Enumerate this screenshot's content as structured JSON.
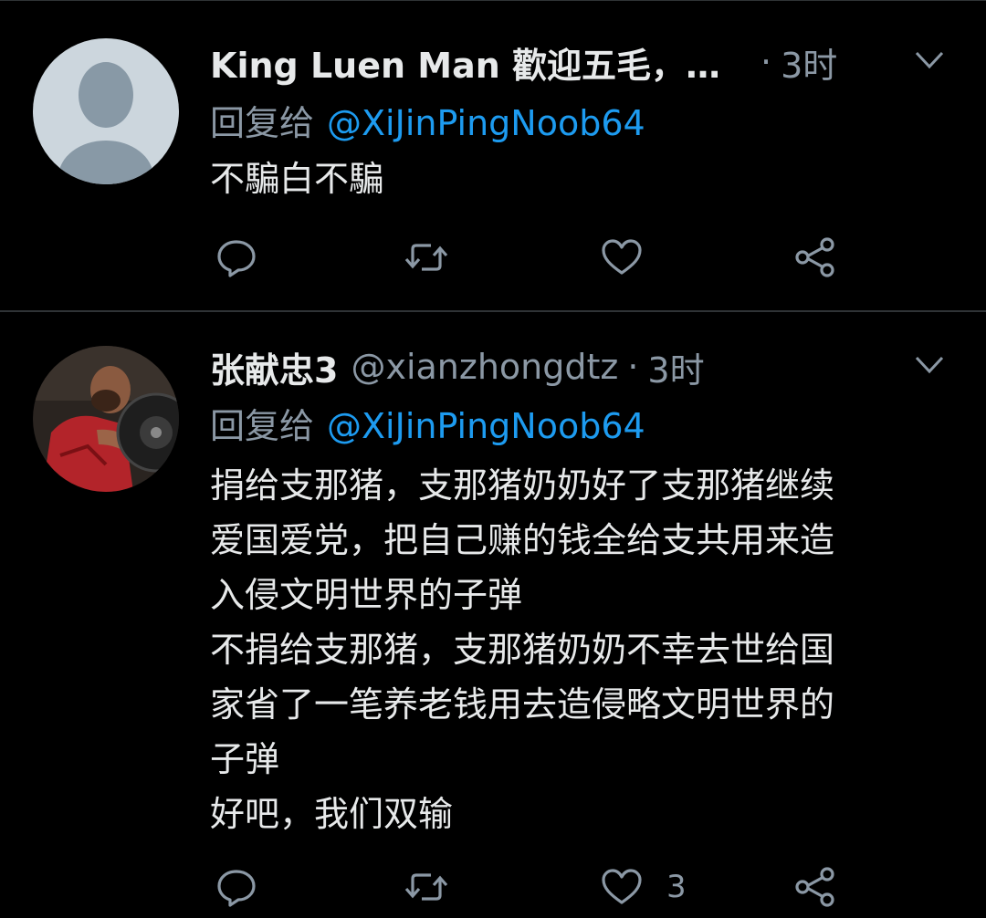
{
  "tweets": [
    {
      "display_name": "King Luen Man 歡迎五毛，…",
      "handle": "",
      "time": "3时",
      "reply_label": "回复给",
      "reply_to": "@XiJinPingNoob64",
      "body_lines": [
        "不騙白不騙"
      ],
      "like_count": "",
      "avatar": "default-avatar"
    },
    {
      "display_name": "张献忠3",
      "handle": "@xianzhongdtz",
      "time": "3时",
      "reply_label": "回复给",
      "reply_to": "@XiJinPingNoob64",
      "body_lines": [
        "捐给支那猪，支那猪奶奶好了支那猪继续",
        "爱国爱党，把自己赚的钱全给支共用来造",
        "入侵文明世界的子弹",
        "不捐给支那猪，支那猪奶奶不幸去世给国",
        "家省了一笔养老钱用去造侵略文明世界的",
        "子弹",
        "好吧，我们双输"
      ],
      "like_count": "3",
      "avatar": "photo-avatar"
    }
  ],
  "separator": "·",
  "icons": [
    "reply-icon",
    "retweet-icon",
    "like-icon",
    "share-icon",
    "chevron-down-icon"
  ],
  "colors": {
    "background": "#000000",
    "text": "#e7e9ea",
    "muted": "#8b98a5",
    "link": "#1d9bf0",
    "divider": "#2f3336"
  }
}
